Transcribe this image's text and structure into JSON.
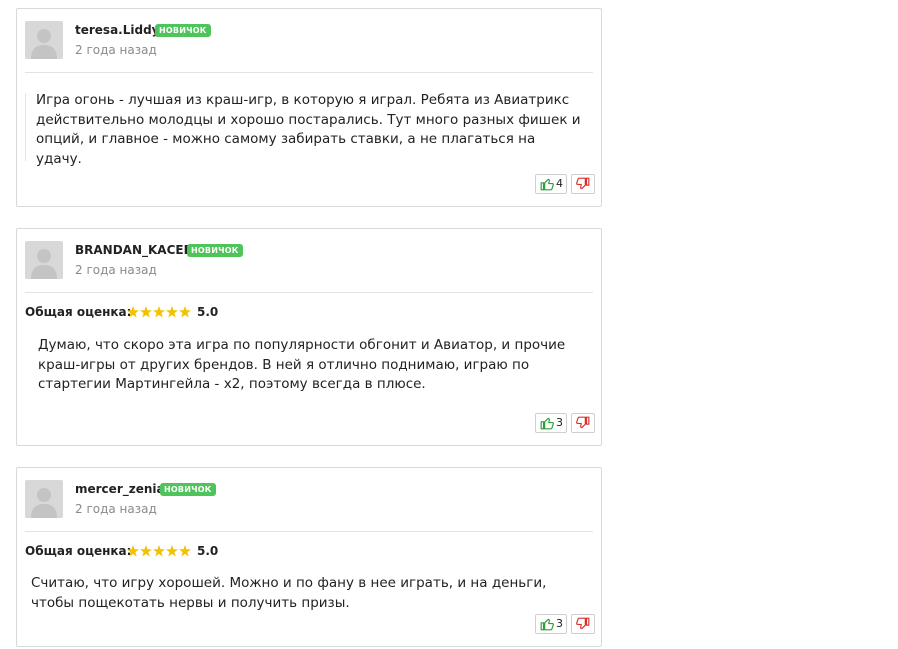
{
  "reviews": [
    {
      "username": "teresa.Liddy",
      "badge": "НОВИЧОК",
      "time_ago": "2 года назад",
      "text": "Игра огонь - лучшая из краш-игр, в которую я играл. Ребята из Авиатрикс действительно молодцы и хорошо постарались. Тут много разных фишек и опций, и главное - можно самому забирать ставки, а не плагаться на удачу.",
      "likes": "4"
    },
    {
      "username": "BRANDAN_KACEE",
      "badge": "НОВИЧОК",
      "time_ago": "2 года назад",
      "rating_label": "Общая оценка:",
      "stars": 5,
      "rating_value": "5.0",
      "text": "Думаю, что скоро эта игра по популярности обгонит и Авиатор, и прочие краш-игры от других брендов. В ней я отлично поднимаю, играю по стартегии Мартингейла - x2, поэтому всегда в плюсе.",
      "likes": "3"
    },
    {
      "username": "mercer_zenia",
      "badge": "НОВИЧОК",
      "time_ago": "2 года назад",
      "rating_label": "Общая оценка:",
      "stars": 5,
      "rating_value": "5.0",
      "text": "Считаю, что игру хорошей. Можно и по фану в нее играть, и на деньги, чтобы пощекотать нервы и получить призы.",
      "likes": "3"
    }
  ],
  "colors": {
    "badge_bg": "#4fc45b",
    "star": "#f2c200",
    "like_icon": "#2e9e3a",
    "dislike_icon": "#d9302c"
  },
  "icons": {
    "avatar": "user-silhouette-icon",
    "like": "thumbs-up-icon",
    "dislike": "thumbs-down-icon",
    "star": "star-icon"
  }
}
